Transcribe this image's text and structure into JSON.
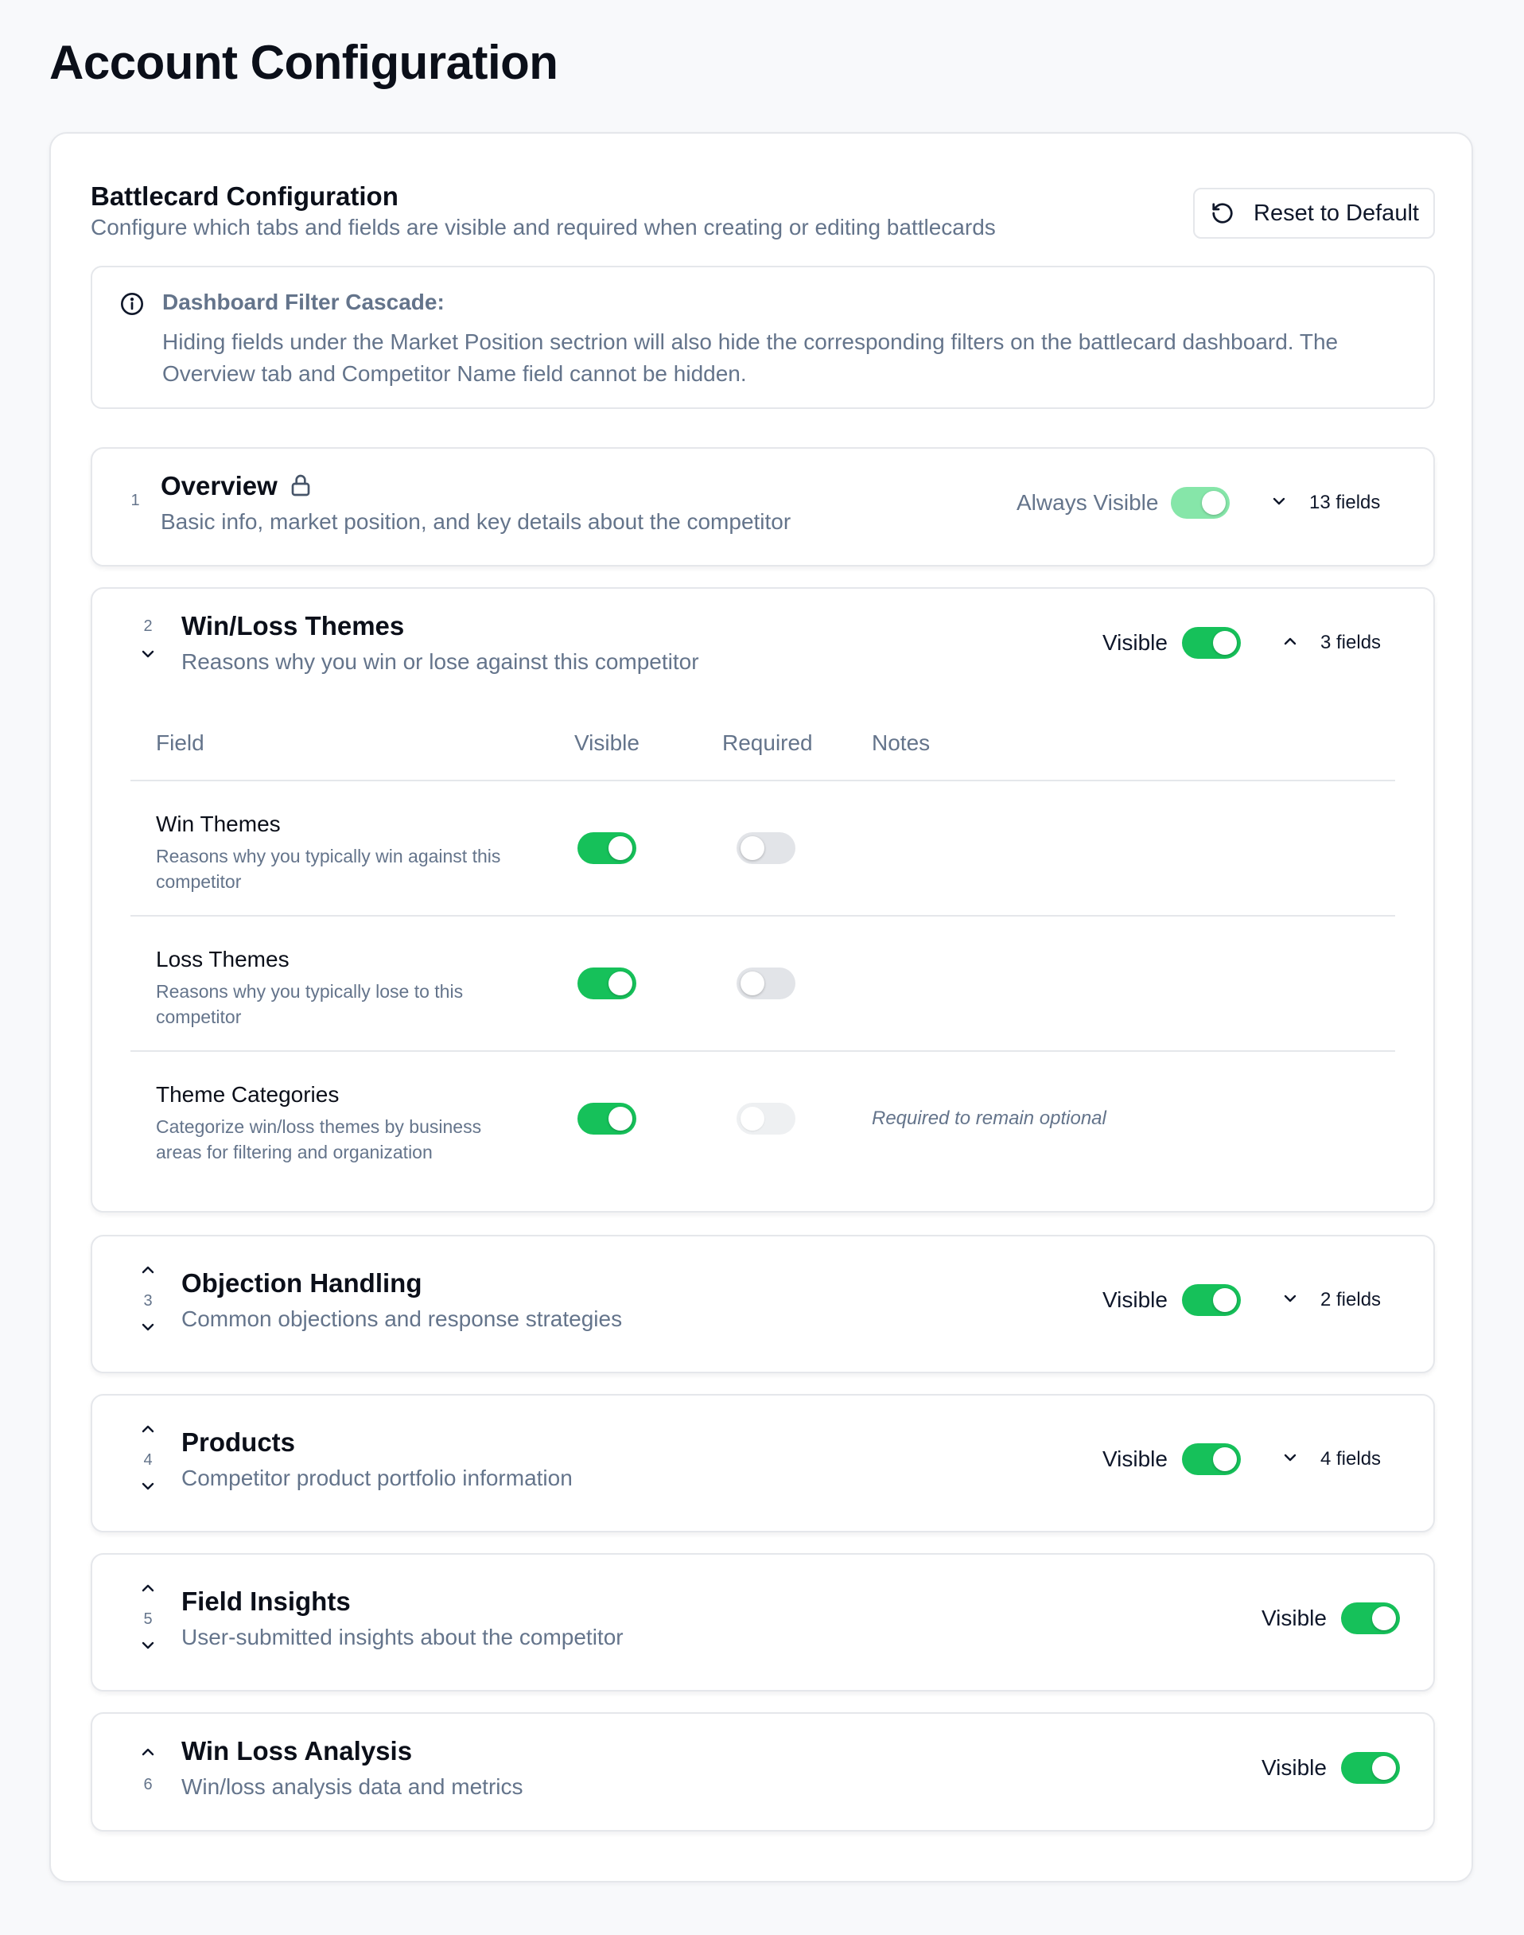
{
  "page": {
    "title": "Account Configuration"
  },
  "card": {
    "title": "Battlecard Configuration",
    "subtitle": "Configure which tabs and fields are visible and required when creating or editing battlecards",
    "reset_label": "Reset to Default"
  },
  "info": {
    "title": "Dashboard Filter Cascade:",
    "text": "Hiding fields under the Market Position sectrion will also hide the corresponding filters on the battlecard dashboard. The Overview tab and Competitor Name field cannot be hidden."
  },
  "sections": [
    {
      "num": "1",
      "title": "Overview",
      "desc": "Basic info, market position, and key details about the competitor",
      "visibility_label": "Always Visible",
      "visible": true,
      "locked": true,
      "fields": "13 fields",
      "expanded": false
    },
    {
      "num": "2",
      "title": "Win/Loss Themes",
      "desc": "Reasons why you win or lose against this competitor",
      "visibility_label": "Visible",
      "visible": true,
      "fields": "3 fields",
      "expanded": true
    },
    {
      "num": "3",
      "title": "Objection Handling",
      "desc": "Common objections and response strategies",
      "visibility_label": "Visible",
      "visible": true,
      "fields": "2 fields",
      "expanded": false
    },
    {
      "num": "4",
      "title": "Products",
      "desc": "Competitor product portfolio information",
      "visibility_label": "Visible",
      "visible": true,
      "fields": "4 fields",
      "expanded": false
    },
    {
      "num": "5",
      "title": "Field Insights",
      "desc": "User-submitted insights about the competitor",
      "visibility_label": "Visible",
      "visible": true
    },
    {
      "num": "6",
      "title": "Win Loss Analysis",
      "desc": "Win/loss analysis data and metrics",
      "visibility_label": "Visible",
      "visible": true
    }
  ],
  "field_table": {
    "headers": {
      "field": "Field",
      "visible": "Visible",
      "required": "Required",
      "notes": "Notes"
    },
    "rows": [
      {
        "name": "Win Themes",
        "desc": "Reasons why you typically win against this competitor",
        "visible": true,
        "required": false,
        "required_enabled": true,
        "note": ""
      },
      {
        "name": "Loss Themes",
        "desc": "Reasons why you typically lose to this competitor",
        "visible": true,
        "required": false,
        "required_enabled": true,
        "note": ""
      },
      {
        "name": "Theme Categories",
        "desc": "Categorize win/loss themes by business areas for filtering and organization",
        "visible": true,
        "required": false,
        "required_enabled": false,
        "note": "Required to remain optional"
      }
    ]
  },
  "colors": {
    "accent_green": "#16c15a",
    "locked_green": "#86e6a9",
    "toggle_off": "#e2e4e8",
    "muted_text": "#64748b"
  },
  "icons": {
    "reset": "rotate-ccw-icon",
    "info": "info-circle-icon",
    "lock": "lock-icon",
    "chevron_up": "chevron-up-icon",
    "chevron_down": "chevron-down-icon"
  }
}
